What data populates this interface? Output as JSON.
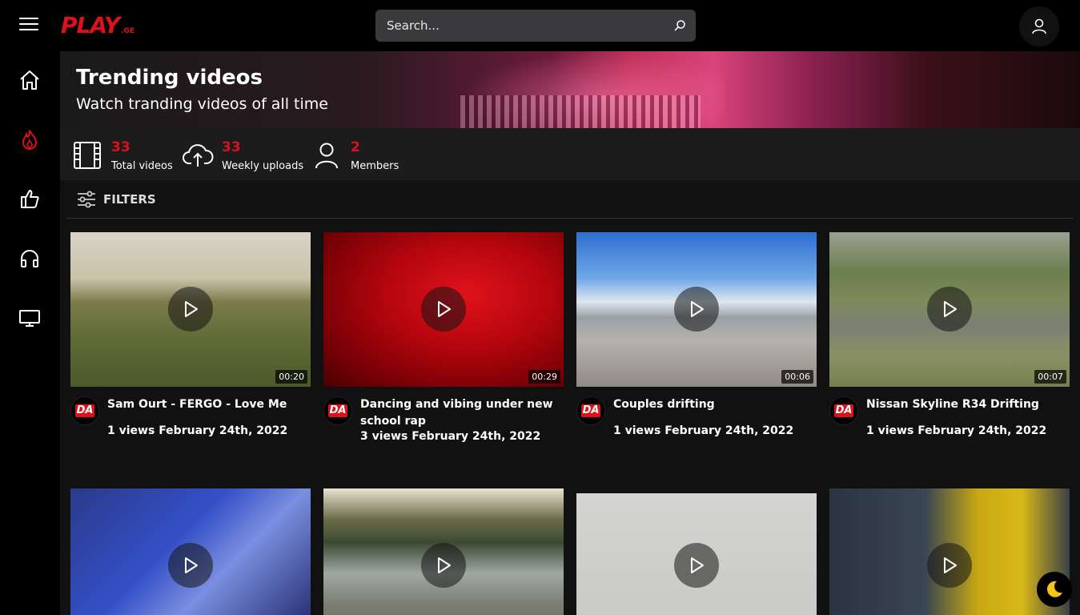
{
  "header": {
    "logo_text": "PLAY",
    "logo_suffix": ".GE",
    "search_placeholder": "Search..."
  },
  "sidebar": {
    "items": [
      {
        "icon": "home-icon"
      },
      {
        "icon": "fire-icon",
        "active": true
      },
      {
        "icon": "thumbs-up-icon"
      },
      {
        "icon": "headphones-icon"
      },
      {
        "icon": "tv-icon"
      }
    ]
  },
  "banner": {
    "title": "Trending videos",
    "subtitle": "Watch tranding videos of all time"
  },
  "stats": [
    {
      "value": "33",
      "label": "Total videos",
      "icon": "film-icon"
    },
    {
      "value": "33",
      "label": "Weekly uploads",
      "icon": "cloud-upload-icon"
    },
    {
      "value": "2",
      "label": "Members",
      "icon": "user-icon"
    }
  ],
  "filters": {
    "label": "FILTERS"
  },
  "videos": [
    {
      "title": "Sam Ourt - FERGO - Love Me",
      "duration": "00:20",
      "views": "1 views",
      "date": "February 24th, 2022",
      "avatar": "DA"
    },
    {
      "title": "Dancing and vibing under new school rap",
      "duration": "00:29",
      "views": "3 views",
      "date": "February 24th, 2022",
      "avatar": "DA"
    },
    {
      "title": "Couples drifting",
      "duration": "00:06",
      "views": "1 views",
      "date": "February 24th, 2022",
      "avatar": "DA"
    },
    {
      "title": "Nissan Skyline R34 Drifting",
      "duration": "00:07",
      "views": "1 views",
      "date": "February 24th, 2022",
      "avatar": "DA"
    }
  ],
  "colors": {
    "accent": "#e0101b",
    "background": "#111111",
    "topbar": "#000000"
  }
}
